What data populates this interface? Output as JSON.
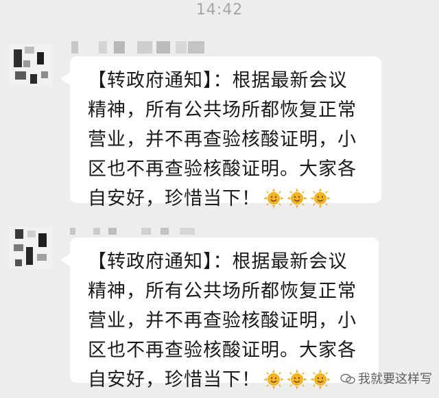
{
  "status": {
    "time": "14:42"
  },
  "messages": [
    {
      "text": "【转政府通知】：根据最新会议\n精神，所有公共场所都恢复正常\n营业，并不再查验核酸证明，小\n区也不再查验核酸证明。大家各\n自安好，珍惜当下！",
      "emoji": [
        "sun-face-emoji",
        "sun-face-emoji",
        "sun-face-emoji"
      ]
    },
    {
      "text": "【转政府通知】：根据最新会议\n精神，所有公共场所都恢复正常\n营业，并不再查验核酸证明，小\n区也不再查验核酸证明。大家各\n自安好，珍惜当下！",
      "emoji": [
        "sun-face-emoji",
        "sun-face-emoji",
        "sun-face-emoji"
      ]
    }
  ],
  "watermark": {
    "text": "我就要这样写",
    "icon": "wechat-icon"
  },
  "colors": {
    "background": "#ededed",
    "bubble": "#ffffff",
    "time": "#a6a6a6",
    "sun": "#f2b325"
  }
}
